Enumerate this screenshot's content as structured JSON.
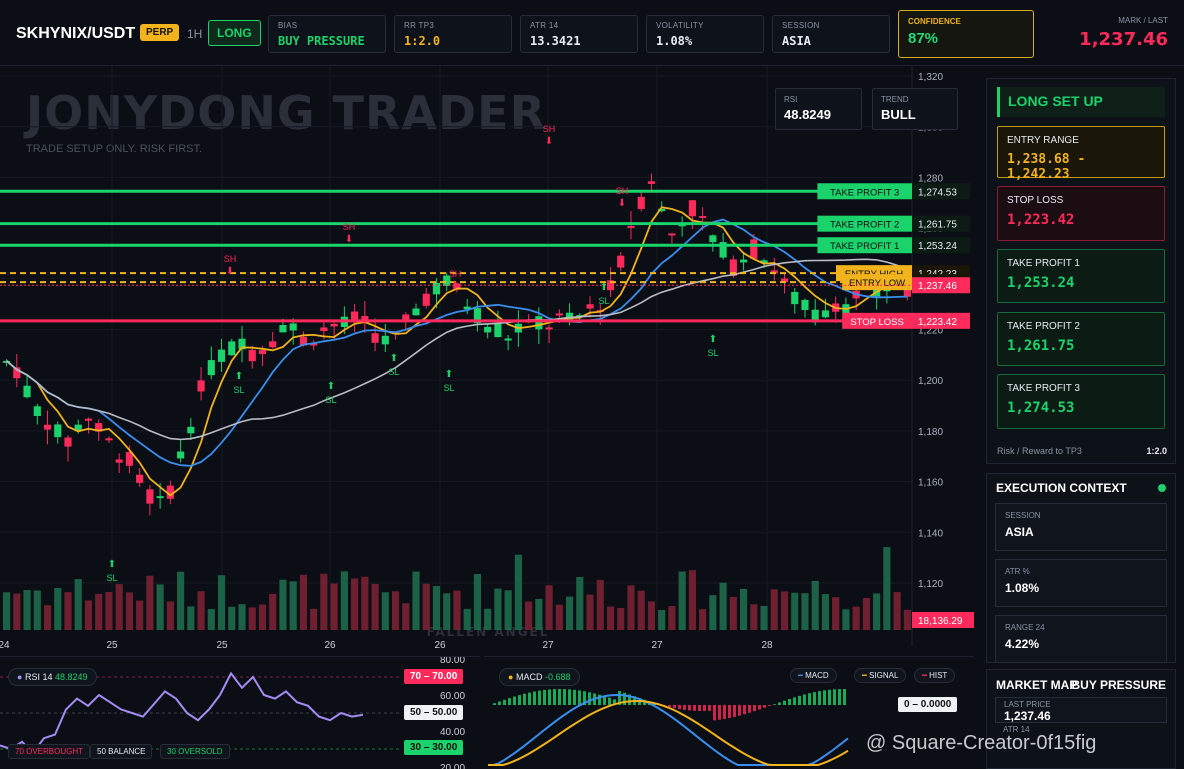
{
  "header": {
    "symbol": "SKHYNIX/USDT",
    "contract": "PERP",
    "timeframe": "1H",
    "direction": "LONG",
    "stats": [
      {
        "key": "BIAS",
        "value": "BUY PRESSURE",
        "color": "#1bd36b"
      },
      {
        "key": "RR TP3",
        "value": "1:2.0",
        "color": "#f2b31c"
      },
      {
        "key": "ATR 14",
        "value": "13.3421",
        "color": "#e8ebf1"
      },
      {
        "key": "VOLATILITY",
        "value": "1.08%",
        "color": "#e8ebf1"
      },
      {
        "key": "SESSION",
        "value": "ASIA",
        "color": "#e8ebf1"
      }
    ],
    "confidence_label": "CONFIDENCE",
    "confidence_value": "87%",
    "mark_label": "MARK / LAST",
    "mark_value": "1,237.46"
  },
  "watermark": {
    "title": "JONYDONG TRADER",
    "subtitle": "TRADE SETUP ONLY. RISK FIRST."
  },
  "mini": {
    "rsi_label": "RSI",
    "rsi_value": "48.8249",
    "trend_label": "TREND",
    "trend_value": "BULL"
  },
  "levels": [
    {
      "label": "TAKE PROFIT 3",
      "price": "1,274.53",
      "value": 1274.53,
      "color": "#1bd36b"
    },
    {
      "label": "TAKE PROFIT 2",
      "price": "1,261.75",
      "value": 1261.75,
      "color": "#1bd36b"
    },
    {
      "label": "TAKE PROFIT 1",
      "price": "1,253.24",
      "value": 1253.24,
      "color": "#1bd36b"
    },
    {
      "label": "ENTRY HIGH",
      "price": "1,242.23",
      "value": 1242.23,
      "color": "#f2b31c"
    },
    {
      "label": "ENTRY LOW",
      "price": "1,238.68",
      "value": 1238.68,
      "color": "#f2b31c"
    },
    {
      "label": "STOP LOSS",
      "price": "1,223.42",
      "value": 1223.42,
      "color": "#ff2a5c"
    }
  ],
  "last_price_tag": "1,237.46",
  "volume_tag": "18,136.29",
  "price_axis": [
    "1,320",
    "1,300",
    "1,280",
    "1,260",
    "1,240",
    "1,220",
    "1,200",
    "1,180",
    "1,160",
    "1,140",
    "1,120"
  ],
  "time_axis": [
    "24",
    "25",
    "25",
    "26",
    "26",
    "27",
    "27",
    "28"
  ],
  "volume_watermark": "FALLEN ANGEL",
  "markers": {
    "sh": "SH",
    "sl": "SL"
  },
  "panel": {
    "title": "LONG SET UP",
    "entry_label": "ENTRY RANGE",
    "entry_value": "1,238.68 - 1,242.23",
    "stop_label": "STOP LOSS",
    "stop_value": "1,223.42",
    "tp1_label": "TAKE PROFIT 1",
    "tp1_value": "1,253.24",
    "tp2_label": "TAKE PROFIT 2",
    "tp2_value": "1,261.75",
    "tp3_label": "TAKE PROFIT 3",
    "tp3_value": "1,274.53",
    "rr_label": "Risk / Reward to TP3",
    "rr_value": "1:2.0"
  },
  "exec": {
    "title": "EXECUTION CONTEXT",
    "session_label": "SESSION",
    "session_value": "ASIA",
    "atr_label": "ATR %",
    "atr_value": "1.08%",
    "range_label": "RANGE 24",
    "range_value": "4.22%"
  },
  "market_map": {
    "title": "MARKET MAP",
    "bias": "BUY PRESSURE",
    "last_label": "LAST PRICE",
    "last_value": "1,237.46",
    "atr_label": "ATR 14"
  },
  "rsi_pane": {
    "title": "RSI 14",
    "value": "48.8249",
    "legend_overbought": "70 OVERBOUGHT",
    "legend_balance": "50 BALANCE",
    "legend_oversold": "30 OVERSOLD",
    "axis": [
      "80.00",
      "60.00",
      "40.00",
      "20.00"
    ],
    "tag70_a": "70",
    "tag70_b": "70.00",
    "tag50_a": "50",
    "tag50_b": "50.00",
    "tag30_a": "30",
    "tag30_b": "30.00"
  },
  "macd_pane": {
    "title": "MACD",
    "value": "-0.688",
    "legend_macd": "MACD",
    "legend_signal": "SIGNAL",
    "legend_hist": "HIST",
    "zero_a": "0",
    "zero_b": "0.0000"
  },
  "source_watermark": "@ Square-Creator-0f15fig",
  "colors": {
    "bull": "#1bd36b",
    "bear": "#ff2a5c",
    "accent": "#f2b31c",
    "ema_fast": "#f2b31c",
    "ema_slow": "#3a8ef0",
    "sma": "#b9bcc4",
    "rsi": "#a58cf5"
  }
}
